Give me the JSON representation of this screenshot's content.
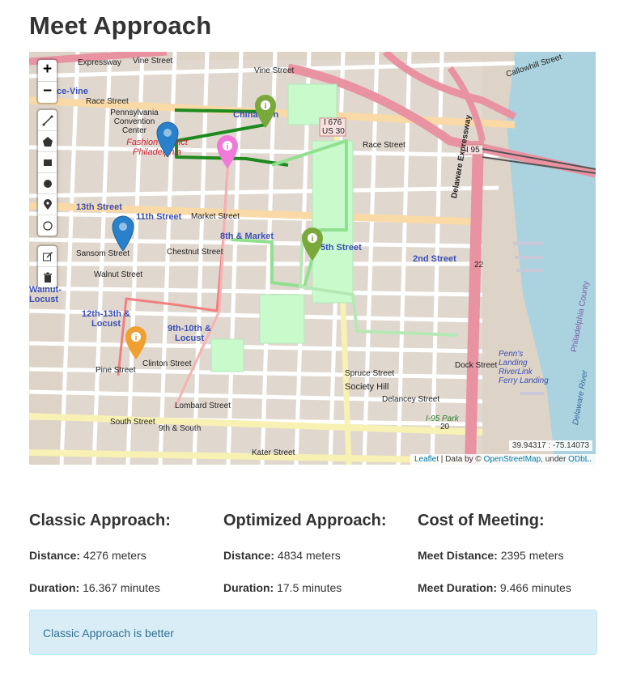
{
  "page": {
    "title": "Meet Approach"
  },
  "map": {
    "zoom_in": "+",
    "zoom_out": "−",
    "coords": "39.94317 : -75.14073",
    "attribution": {
      "leaflet": "Leaflet",
      "data_by": "| Data by ©",
      "osm": "OpenStreetMap",
      "under": ", under",
      "odbl": "ODbL",
      "end": "."
    },
    "labels": {
      "vine_st": "Vine Street",
      "vine_st2": "Vine Street",
      "callowhill": "Callowhill Street",
      "race_vine": "Race-Vine",
      "race_st": "Race Street",
      "race_st2": "Race Street",
      "penn_conv": "Pennsylvania Convention Center",
      "chinatown": "Chinatown",
      "fashion": "Fashion District Philadelphia",
      "i676": "I 676",
      "us30": "US 30",
      "i95": "I 95",
      "thirteenth": "13th Street",
      "eleventh": "11th Street",
      "market_st": "Market Street",
      "eighth_market": "8th & Market",
      "fifth_st": "5th Street",
      "chestnut": "Chestnut Street",
      "sansom": "Sansom Street",
      "walnut": "Walnut Street",
      "walnut_locust": "Walnut-Locust",
      "twelve_thirteen": "12th-13th & Locust",
      "nine_ten": "9th-10th & Locust",
      "second_st": "2nd Street",
      "delaware_exp": "Delaware Expressway",
      "pine_st": "Pine Street",
      "clinton": "Clinton Street",
      "spruce": "Spruce Street",
      "society_hill": "Society Hill",
      "lombard": "Lombard Street",
      "south_st": "South Street",
      "ninth_south": "9th & South",
      "delancey": "Delancey Street",
      "dock_st": "Dock Street",
      "penns_landing": "Penn's Landing RiverLink Ferry Landing",
      "delaware_river": "Delaware River",
      "phila_county": "Philadelphia County",
      "i95_park": "I-95 Park",
      "shield_22": "22",
      "shield_20": "20",
      "katek": "Kater Street"
    }
  },
  "results": {
    "classic": {
      "heading": "Classic Approach:",
      "distance_label": "Distance:",
      "distance_value": "4276 meters",
      "duration_label": "Duration:",
      "duration_value": "16.367 minutes"
    },
    "optimized": {
      "heading": "Optimized Approach:",
      "distance_label": "Distance:",
      "distance_value": "4834 meters",
      "duration_label": "Duration:",
      "duration_value": "17.5 minutes"
    },
    "meeting": {
      "heading": "Cost of Meeting:",
      "distance_label": "Meet Distance:",
      "distance_value": "2395 meters",
      "duration_label": "Meet Duration:",
      "duration_value": "9.466 minutes"
    }
  },
  "verdict": "Classic Approach is better",
  "colors": {
    "route_dark_green": "#1e8a1e",
    "route_light_green": "#8fe08f",
    "route_red": "#f08080",
    "route_pink": "#f4a6a6",
    "marker_blue": "#2a81cb",
    "marker_green": "#7aa83a",
    "marker_pink": "#f07ad8",
    "marker_orange": "#f0a030",
    "water": "#aad3df"
  }
}
